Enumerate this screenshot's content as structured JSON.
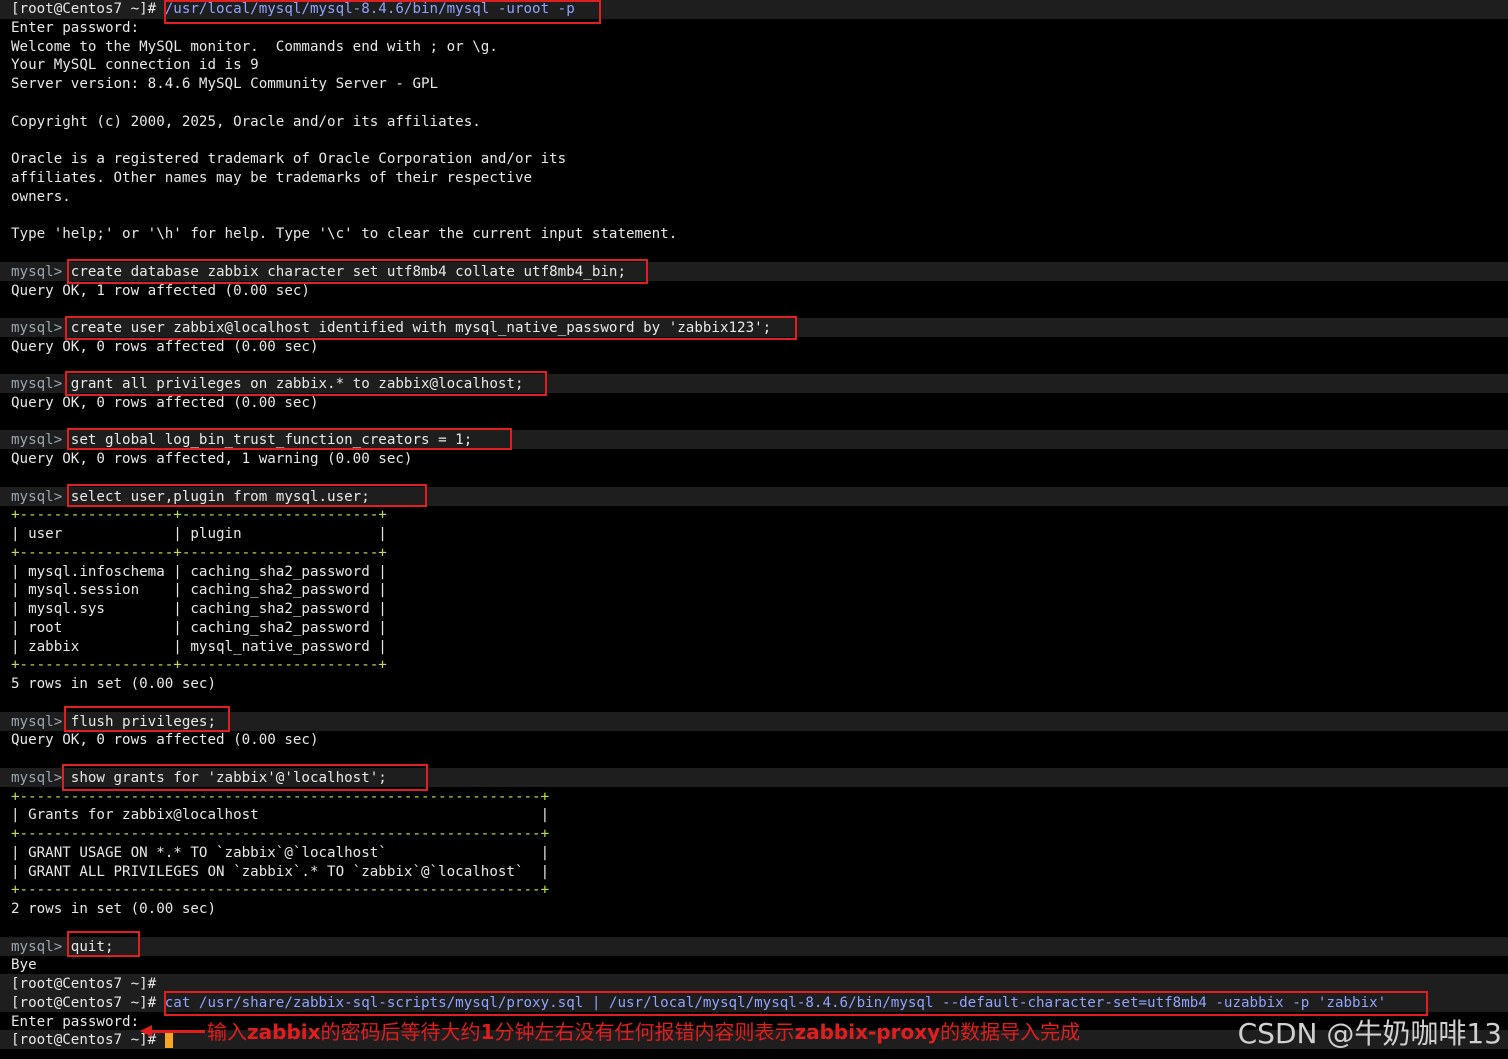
{
  "terminal": {
    "prompt_root": "[root@Centos7 ~]#",
    "prompt_mysql": "mysql>",
    "cmd_login": "/usr/local/mysql/mysql-8.4.6/bin/mysql -uroot -p",
    "enter_password": "Enter password:",
    "welcome": "Welcome to the MySQL monitor.  Commands end with ; or \\g.",
    "conn_id": "Your MySQL connection id is 9",
    "server_version": "Server version: 8.4.6 MySQL Community Server - GPL",
    "copyright": "Copyright (c) 2000, 2025, Oracle and/or its affiliates.",
    "oracle1": "Oracle is a registered trademark of Oracle Corporation and/or its",
    "oracle2": "affiliates. Other names may be trademarks of their respective",
    "oracle3": "owners.",
    "help": "Type 'help;' or '\\h' for help. Type '\\c' to clear the current input statement.",
    "cmd1": "create database zabbix character set utf8mb4 collate utf8mb4_bin;",
    "res1": "Query OK, 1 row affected (0.00 sec)",
    "cmd2": "create user zabbix@localhost identified with mysql_native_password by 'zabbix123';",
    "res2": "Query OK, 0 rows affected (0.00 sec)",
    "cmd3": "grant all privileges on zabbix.* to zabbix@localhost;",
    "res3": "Query OK, 0 rows affected (0.00 sec)",
    "cmd4": "set global log_bin_trust_function_creators = 1;",
    "res4": "Query OK, 0 rows affected, 1 warning (0.00 sec)",
    "cmd5": "select user,plugin from mysql.user;",
    "table1_border": "+------------------+-----------------------+",
    "table1_header": "| user             | plugin                |",
    "table1_rows": [
      "| mysql.infoschema | caching_sha2_password |",
      "| mysql.session    | caching_sha2_password |",
      "| mysql.sys        | caching_sha2_password |",
      "| root             | caching_sha2_password |",
      "| zabbix           | mysql_native_password |"
    ],
    "res5": "5 rows in set (0.00 sec)",
    "cmd6": "flush privileges;",
    "res6": "Query OK, 0 rows affected (0.00 sec)",
    "cmd7": "show grants for 'zabbix'@'localhost';",
    "table2_border": "+-------------------------------------------------------------+",
    "table2_header": "| Grants for zabbix@localhost                                 |",
    "table2_rows": [
      "| GRANT USAGE ON *.* TO `zabbix`@`localhost`                  |",
      "| GRANT ALL PRIVILEGES ON `zabbix`.* TO `zabbix`@`localhost`  |"
    ],
    "res7": "2 rows in set (0.00 sec)",
    "cmd8": "quit;",
    "bye": "Bye",
    "cmd_import": "cat /usr/share/zabbix-sql-scripts/mysql/proxy.sql | /usr/local/mysql/mysql-8.4.6/bin/mysql --default-character-set=utf8mb4 -uzabbix -p 'zabbix'",
    "enter_password2": "Enter password:"
  },
  "annotation": {
    "p1": "输入",
    "b1": "zabbix",
    "p2": "的密码后等待大约",
    "b2": "1",
    "p3": "分钟左右没有任何报错内容则表示",
    "b3": "zabbix-proxy",
    "p4": "的数据导入完成"
  },
  "watermark": "CSDN @牛奶咖啡13",
  "colors": {
    "highlight_box": "#e02020",
    "annotation": "#e11d1d",
    "cursor": "#f5a623"
  }
}
